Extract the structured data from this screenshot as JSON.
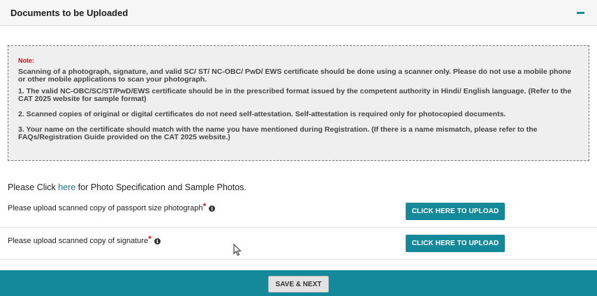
{
  "section": {
    "title": "Documents to be Uploaded",
    "collapse_icon": "minus-icon"
  },
  "note": {
    "label": "Note:",
    "paragraphs": [
      "Scanning of a photograph, signature, and valid SC/ ST/ NC-OBC/ PwD/ EWS certificate should be done using a scanner only. Please do not use a mobile phone or other mobile applications to scan your photograph.",
      "1. The valid NC-OBC/SC/ST/PwD/EWS certificate should be in the prescribed format issued by the competent authority in Hindi/ English language. (Refer to the CAT 2025 website for sample format)",
      "2. Scanned copies of original or digital certificates do not need self-attestation. Self-attestation is required only for photocopied documents.",
      "3. Your name on the certificate should match with the name you have mentioned during Registration. (If there is a name mismatch, please refer to the FAQs/Registration Guide provided on the CAT 2025 website.)"
    ]
  },
  "photo_spec": {
    "prefix": "Please Click ",
    "link": "here",
    "suffix": " for Photo Specification and Sample Photos."
  },
  "uploads": {
    "photo": {
      "label": "Please upload scanned copy of passport size photograph",
      "required_mark": "*",
      "info_icon": "i",
      "button": "CLICK HERE TO UPLOAD"
    },
    "signature": {
      "label": "Please upload scanned copy of signature",
      "required_mark": "*",
      "info_icon": "i",
      "button": "CLICK HERE TO UPLOAD"
    }
  },
  "footer": {
    "save_label": "SAVE & NEXT"
  },
  "colors": {
    "accent": "#14899a",
    "required": "#d01010",
    "link": "#1d6ea0"
  }
}
